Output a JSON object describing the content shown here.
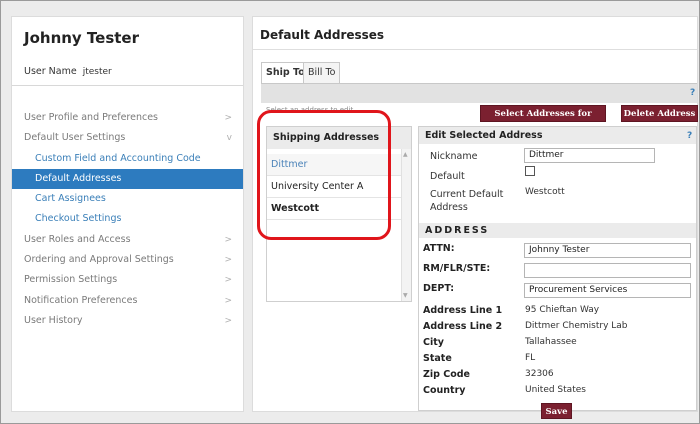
{
  "profile": {
    "full_name": "Johnny Tester",
    "username_label": "User Name",
    "username_value": "jtester"
  },
  "sidebar": {
    "items": [
      {
        "label": "User Profile and Preferences",
        "chevron": ">"
      },
      {
        "label": "Default User Settings",
        "chevron": "v"
      },
      {
        "label": "Custom Field and Accounting Code Defaults"
      },
      {
        "label": "Default Addresses"
      },
      {
        "label": "Cart Assignees"
      },
      {
        "label": "Checkout Settings"
      },
      {
        "label": "User Roles and Access",
        "chevron": ">"
      },
      {
        "label": "Ordering and Approval Settings",
        "chevron": ">"
      },
      {
        "label": "Permission Settings",
        "chevron": ">"
      },
      {
        "label": "Notification Preferences",
        "chevron": ">"
      },
      {
        "label": "User History",
        "chevron": ">"
      }
    ]
  },
  "main": {
    "title": "Default Addresses",
    "tabs": [
      {
        "label": "Ship To",
        "active": true
      },
      {
        "label": "Bill To",
        "active": false
      }
    ],
    "help_glyph": "?",
    "select_hint": "Select an address to edit",
    "buttons": {
      "select_addresses": "Select Addresses for Profile",
      "delete_address": "Delete Address",
      "save": "Save"
    }
  },
  "shipping": {
    "header": "Shipping Addresses",
    "items": [
      "Dittmer",
      "University Center A",
      "Westcott"
    ],
    "scroll_up": "▲",
    "scroll_down": "▼"
  },
  "edit": {
    "header": "Edit Selected Address",
    "nickname_label": "Nickname",
    "nickname_value": "Dittmer",
    "default_label": "Default",
    "current_default_label_1": "Current Default",
    "current_default_label_2": "Address",
    "current_default_value": "Westcott",
    "address_band": "ADDRESS",
    "attn_label": "ATTN:",
    "attn_value": "Johnny Tester",
    "rm_label": "RM/FLR/STE:",
    "rm_value": "",
    "dept_label": "DEPT:",
    "dept_value": "Procurement Services",
    "line1_label": "Address Line 1",
    "line1_value": "95 Chieftan Way",
    "line2_label": "Address Line 2",
    "line2_value": "Dittmer Chemistry Lab",
    "city_label": "City",
    "city_value": "Tallahassee",
    "state_label": "State",
    "state_value": "FL",
    "zip_label": "Zip Code",
    "zip_value": "32306",
    "country_label": "Country",
    "country_value": "United States"
  },
  "colors": {
    "accent": "#2d7bbf",
    "button": "#7b2030",
    "highlight_ring": "#e0151b"
  }
}
